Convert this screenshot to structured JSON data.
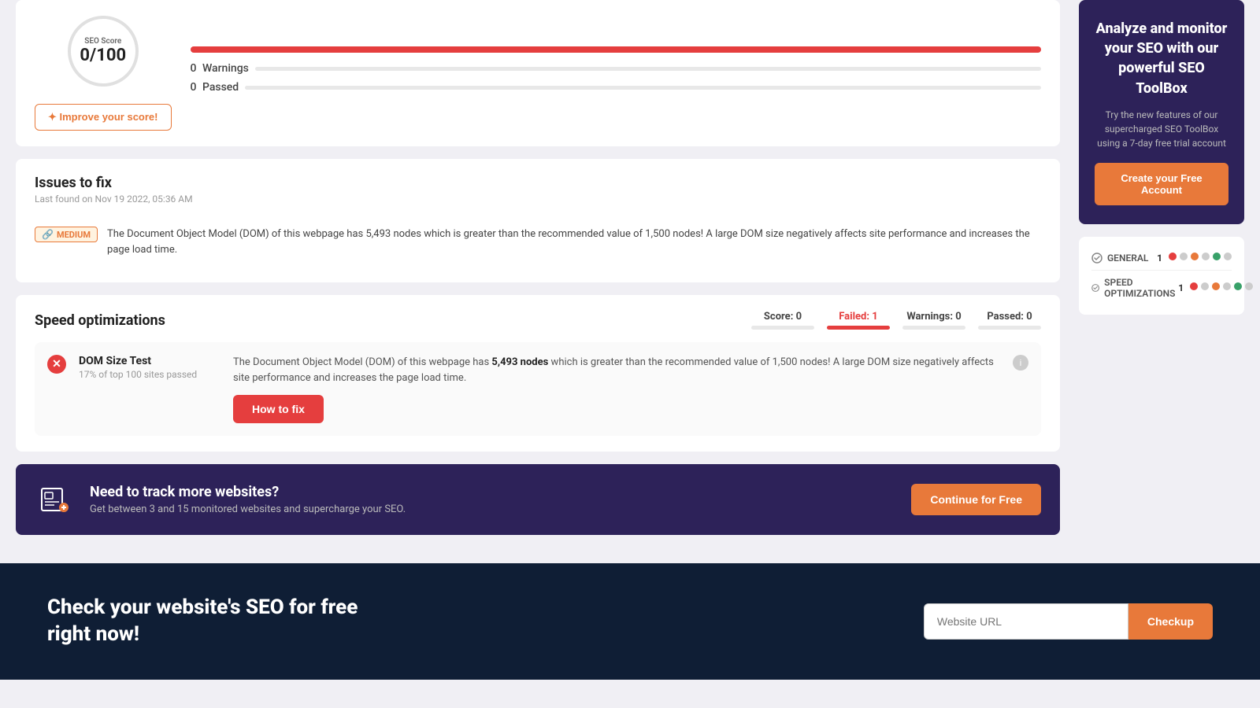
{
  "score": {
    "label": "SEO Score",
    "value": "0/100"
  },
  "metrics": {
    "warnings_count": "0",
    "warnings_label": "Warnings",
    "passed_count": "0",
    "passed_label": "Passed"
  },
  "improve_btn": "✦ Improve your score!",
  "issues": {
    "title": "Issues to fix",
    "subtitle": "Last found on Nov 19 2022, 05:36 AM",
    "badge": "MEDIUM",
    "issue_text": "The Document Object Model (DOM) of this webpage has 5,493 nodes which is greater than the recommended value of 1,500 nodes! A large DOM size negatively affects site performance and increases the page load time."
  },
  "speed": {
    "title": "Speed optimizations",
    "score_label": "Score:",
    "score_value": "0",
    "failed_label": "Failed:",
    "failed_value": "1",
    "warnings_label": "Warnings:",
    "warnings_value": "0",
    "passed_label": "Passed:",
    "passed_value": "0",
    "test": {
      "name": "DOM Size Test",
      "sub": "17% of top 100 sites passed",
      "desc_part1": "The Document Object Model (DOM) of this webpage has ",
      "desc_bold": "5,493 nodes",
      "desc_part2": " which is greater than the recommended value of 1,500 nodes! A large DOM size negatively affects site performance and increases the page load time.",
      "how_to_fix": "How to fix"
    }
  },
  "track_banner": {
    "title": "Need to track more websites?",
    "subtitle": "Get between 3 and 15 monitored websites and supercharge your SEO.",
    "button": "Continue for Free"
  },
  "footer": {
    "title": "Check your website's SEO for free right now!",
    "input_placeholder": "Website URL",
    "button": "Checkup"
  },
  "sidebar": {
    "promo": {
      "title": "Analyze and monitor your SEO with our powerful SEO ToolBox",
      "subtitle": "Try the new features of our supercharged SEO ToolBox using a 7-day free trial account",
      "button": "Create your Free Account"
    },
    "checklist": [
      {
        "label": "GENERAL",
        "num": "1",
        "dots": [
          "red",
          "gray",
          "orange",
          "gray",
          "green",
          "gray"
        ]
      },
      {
        "label": "SPEED OPTIMIZATIONS",
        "num": "1",
        "dots": [
          "red",
          "gray",
          "orange",
          "gray",
          "green",
          "gray"
        ]
      }
    ]
  }
}
